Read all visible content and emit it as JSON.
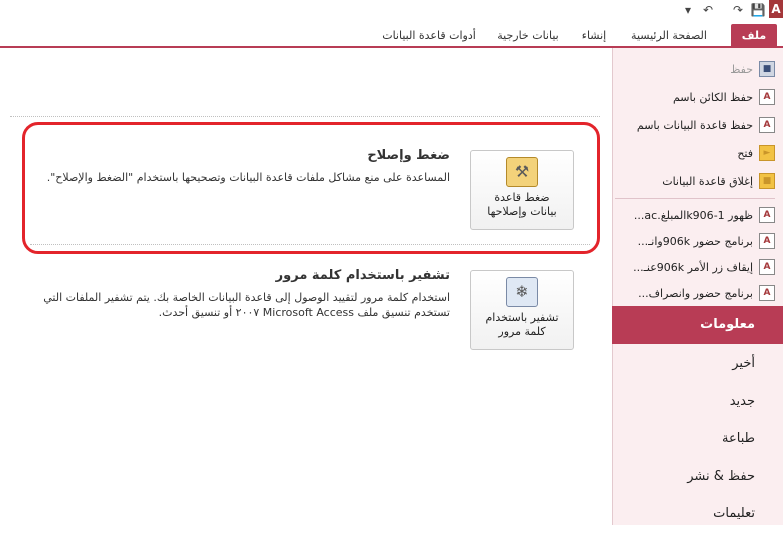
{
  "app": {
    "logo_letter": "A"
  },
  "quick_access": {
    "save_icon": "save-icon",
    "undo_icon": "undo-icon",
    "redo_icon": "redo-icon",
    "customize_icon": "customize-icon"
  },
  "tabs": {
    "file": "ملف",
    "home": "الصفحة الرئيسية",
    "create": "إنشاء",
    "external": "بيانات خارجية",
    "db_tools": "أدوات قاعدة البيانات"
  },
  "sidebar": {
    "commands": [
      {
        "label": "حفظ",
        "icon": "save-icon",
        "enabled": false
      },
      {
        "label": "حفظ الكائن باسم",
        "icon": "save-object-as-icon",
        "enabled": true
      },
      {
        "label": "حفظ قاعدة البيانات باسم",
        "icon": "save-database-as-icon",
        "enabled": true
      },
      {
        "label": "فتح",
        "icon": "open-folder-icon",
        "enabled": true
      },
      {
        "label": "إغلاق قاعدة البيانات",
        "icon": "close-database-icon",
        "enabled": true
      }
    ],
    "recent": [
      {
        "label": "ظهور 1-k906المبلغ.ac...",
        "icon": "access-file-icon"
      },
      {
        "label": "برنامج حضور 906kوانـ...",
        "icon": "access-file-icon"
      },
      {
        "label": "إيقاف زر الأمر 906kعنـ...",
        "icon": "access-file-icon"
      },
      {
        "label": "برنامج حضور وانصراف...",
        "icon": "access-file-icon"
      }
    ],
    "nav": {
      "info": "معلومات",
      "recent": "أخير",
      "new": "جديد",
      "print": "طباعة",
      "save_publish": "حفظ & نشر",
      "help": "تعليمات"
    }
  },
  "main": {
    "compact": {
      "button_label_line1": "ضغط قاعدة",
      "button_label_line2": "بيانات وإصلاحها",
      "title": "ضغط وإصلاح",
      "description": "المساعدة على منع مشاكل ملفات قاعدة البيانات وتصحيحها باستخدام \"الضغط والإصلاح\"."
    },
    "encrypt": {
      "button_label_line1": "تشفير باستخدام",
      "button_label_line2": "كلمة مرور",
      "title": "تشفير باستخدام كلمة مرور",
      "description": "استخدام كلمة مرور لتقييد الوصول إلى قاعدة البيانات الخاصة بك. يتم تشفير الملفات التي تستخدم تنسيق ملف Microsoft Access ٢٠٠٧ أو تنسيق أحدث."
    }
  },
  "colors": {
    "accent": "#b83c55",
    "highlight": "#e3242b",
    "sidebar_bg": "#fbeef0"
  }
}
